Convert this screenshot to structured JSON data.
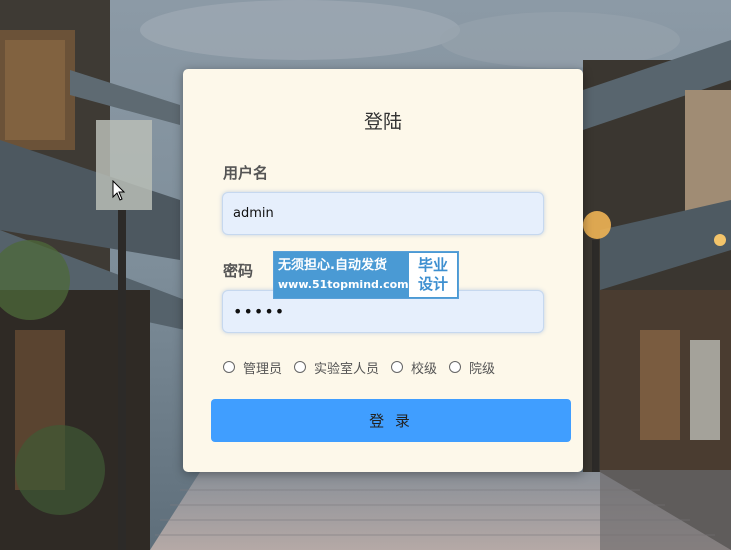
{
  "login": {
    "title": "登陆",
    "username_label": "用户名",
    "username_value": "admin",
    "password_label": "密码",
    "password_value": "•••••",
    "roles": [
      "管理员",
      "实验室人员",
      "校级",
      "院级"
    ],
    "submit_label": "登 录"
  },
  "watermark": {
    "line1": "无须担心.自动发货",
    "line2": "www.51topmind.com",
    "badge_top": "毕业",
    "badge_bottom": "设计"
  },
  "colors": {
    "card_bg": "#fdf8ea",
    "input_bg": "#e6effc",
    "button_bg": "#409eff",
    "watermark_blue": "#4a9ad4"
  }
}
